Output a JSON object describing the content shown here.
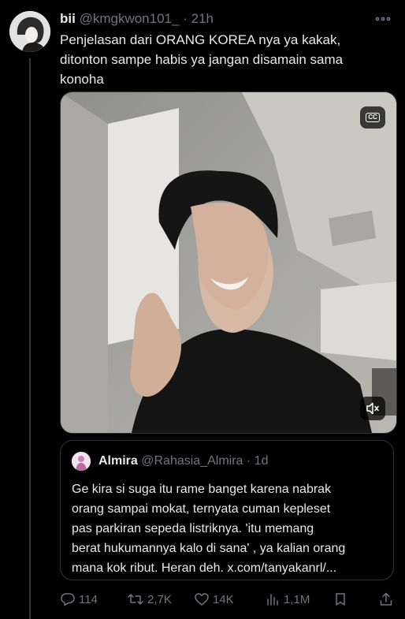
{
  "tweet": {
    "author_name": "bii",
    "handle": "@kmgkwon101_",
    "separator": "·",
    "time": "21h",
    "text_lines": [
      "Penjelasan dari ORANG KOREA nya ya kakak,",
      "ditonton sampe habis ya jangan disamain sama",
      "konoha"
    ]
  },
  "video": {
    "cc_label": "CC",
    "muted": true
  },
  "quote": {
    "author_name": "Almira",
    "handle": "@Rahasia_Almira",
    "separator": "·",
    "time": "1d",
    "text_lines": [
      "Ge kira si suga itu rame banget karena nabrak",
      "orang sampai mokat, ternyata cuman kepleset",
      "pas parkiran sepeda listriknya. 'itu memang",
      "berat hukumannya kalo di sana' , ya kalian orang",
      "mana kok ribut. Heran deh. x.com/tanyakanrl/..."
    ]
  },
  "actions": {
    "replies": "114",
    "reposts": "2,7K",
    "likes": "14K",
    "views": "1,1M"
  },
  "colors": {
    "background": "#000000",
    "text": "#e7e9ea",
    "secondary": "#71767b",
    "border": "#2f3336"
  }
}
